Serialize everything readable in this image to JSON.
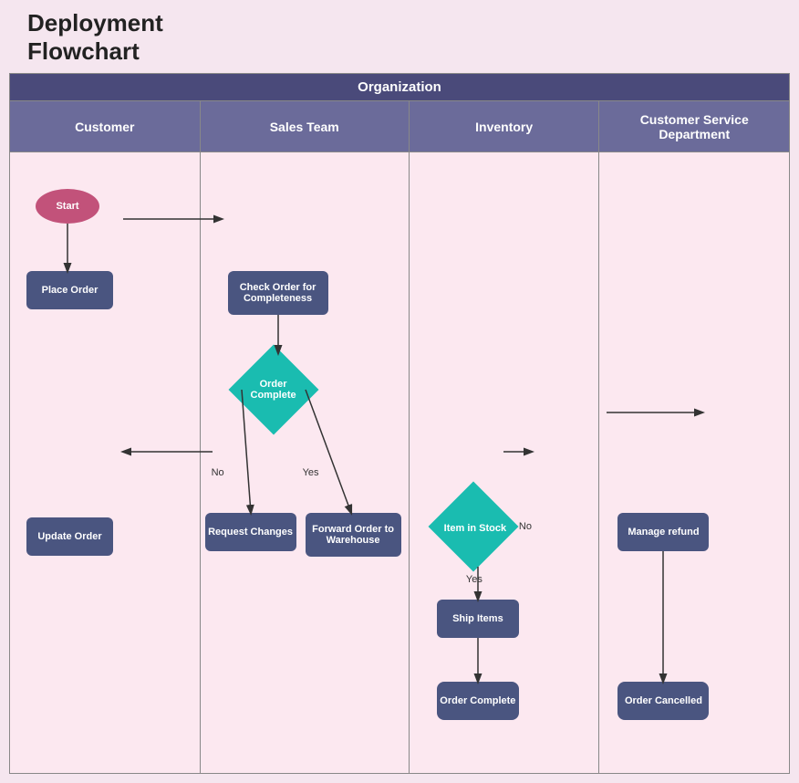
{
  "title": "Deployment\nFlowchart",
  "org_header": "Organization",
  "lanes": [
    {
      "id": "customer",
      "label": "Customer"
    },
    {
      "id": "sales",
      "label": "Sales Team"
    },
    {
      "id": "inventory",
      "label": "Inventory"
    },
    {
      "id": "csd",
      "label": "Customer Service Department"
    }
  ],
  "nodes": {
    "start": "Start",
    "place_order": "Place Order",
    "check_order": "Check Order for Completeness",
    "order_complete": "Order Complete",
    "request_changes": "Request Changes",
    "forward_order": "Forward Order to Warehouse",
    "update_order": "Update Order",
    "item_in_stock": "Item in Stock",
    "manage_refund": "Manage refund",
    "ship_items": "Ship Items",
    "order_complete2": "Order Complete",
    "order_cancelled": "Order Cancelled"
  },
  "labels": {
    "no": "No",
    "yes": "Yes"
  }
}
